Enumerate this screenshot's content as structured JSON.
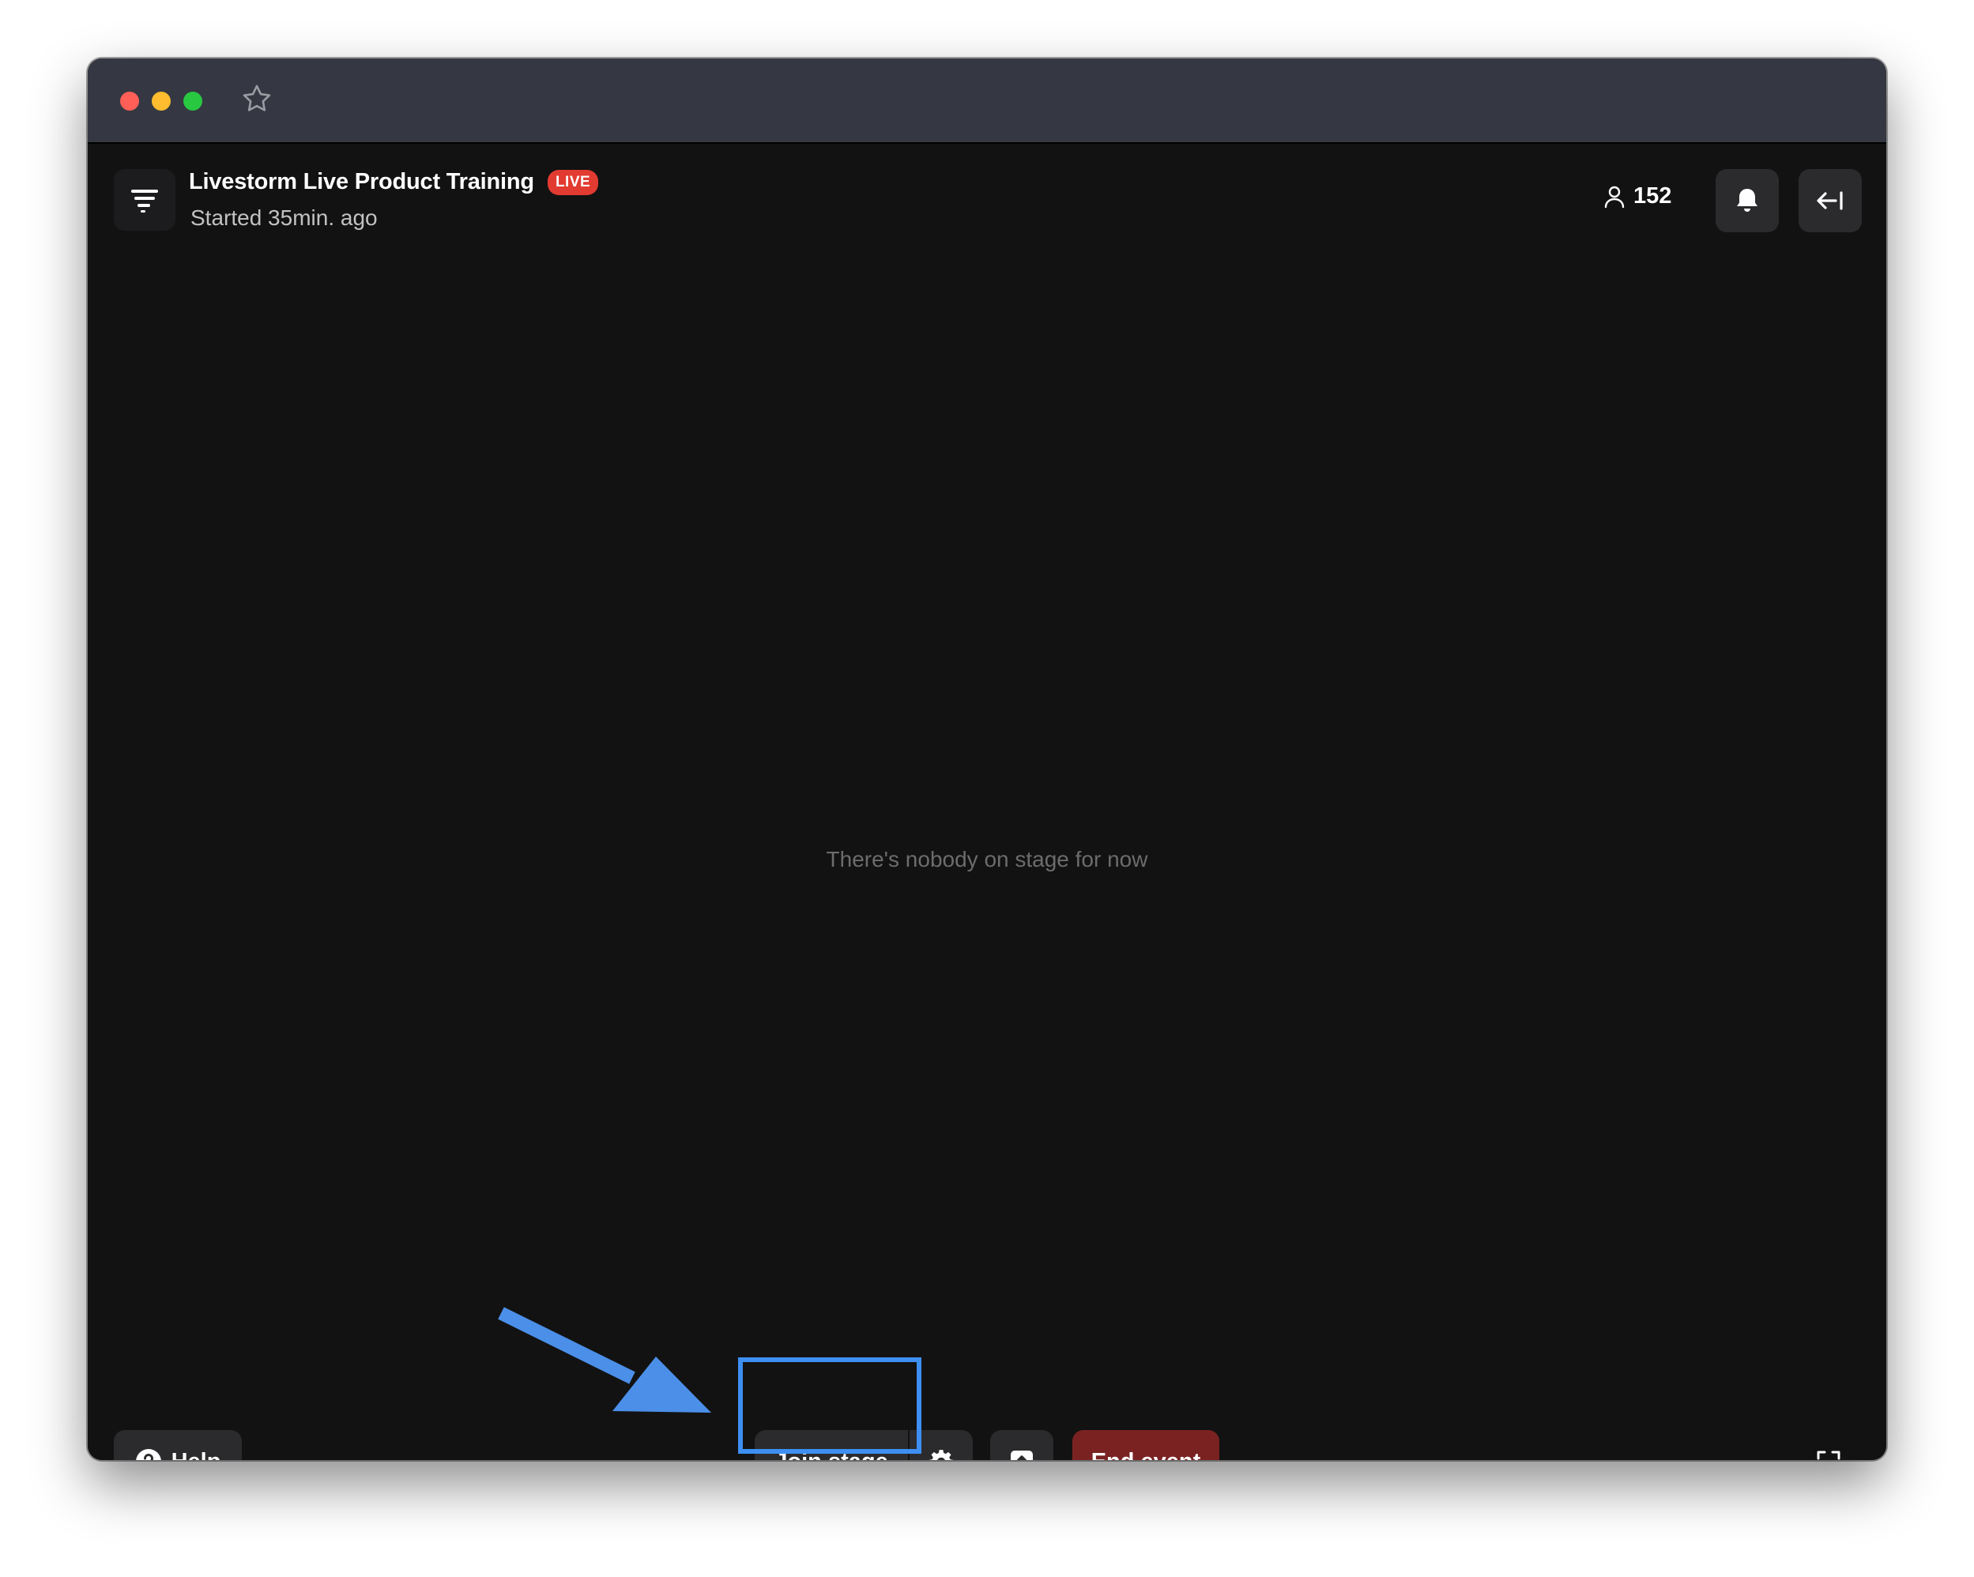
{
  "window": {
    "traffic_lights": [
      "close",
      "minimize",
      "maximize"
    ],
    "bookmark_icon": "star-icon"
  },
  "header": {
    "title": "Livestorm Live Product Training",
    "live_badge": "LIVE",
    "subtitle": "Started 35min. ago",
    "attendee_count": "152",
    "icons": [
      "menu-icon",
      "user-icon",
      "bell-icon",
      "exit-icon"
    ]
  },
  "stage": {
    "empty_message": "There's nobody on stage for now"
  },
  "toolbar": {
    "help_label": "Help",
    "join_stage_label": "Join stage",
    "end_event_label": "End event",
    "icons": [
      "help-icon",
      "settings-icon",
      "share-screen-icon",
      "fullscreen-icon"
    ]
  },
  "annotation": {
    "highlight_color": "#3d8ff2",
    "arrow_color": "#4b8fe8"
  },
  "colors": {
    "live_badge": "#e23b31",
    "end_event": "#7a2222",
    "background": "#121212",
    "button": "#2b2b2d"
  }
}
